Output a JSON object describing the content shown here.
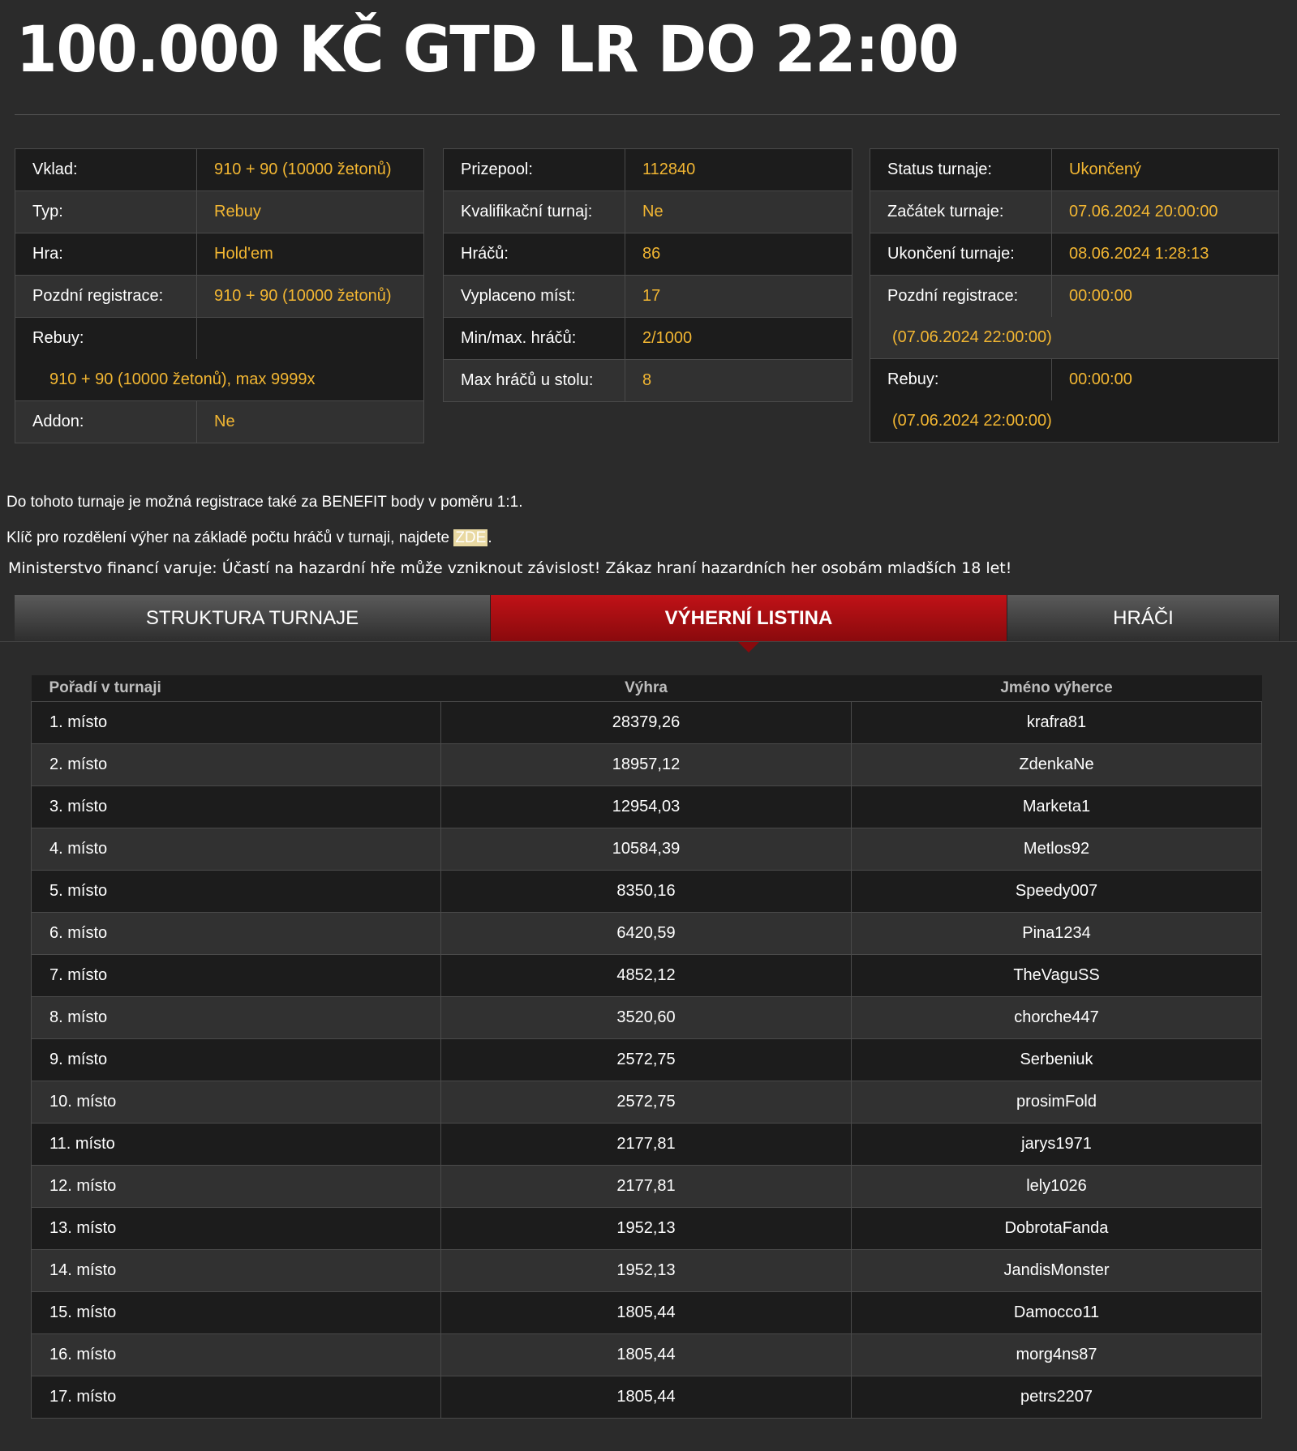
{
  "title": "100.000 KČ GTD LR DO 22:00",
  "info_left": [
    {
      "label": "Vklad:",
      "value": "910 + 90 (10000 žetonů)"
    },
    {
      "label": "Typ:",
      "value": "Rebuy"
    },
    {
      "label": "Hra:",
      "value": "Hold'em"
    },
    {
      "label": "Pozdní registrace:",
      "value": "910 + 90 (10000 žetonů)"
    },
    {
      "label": "Rebuy:",
      "value": "",
      "extra": "910 + 90 (10000 žetonů), max 9999x"
    },
    {
      "label": "Addon:",
      "value": "Ne"
    }
  ],
  "info_middle": [
    {
      "label": "Prizepool:",
      "value": "112840"
    },
    {
      "label": "Kvalifikační turnaj:",
      "value": "Ne"
    },
    {
      "label": "Hráčů:",
      "value": "86"
    },
    {
      "label": "Vyplaceno míst:",
      "value": "17"
    },
    {
      "label": "Min/max. hráčů:",
      "value": "2/1000"
    },
    {
      "label": "Max hráčů u stolu:",
      "value": "8"
    }
  ],
  "info_right": [
    {
      "label": "Status turnaje:",
      "value": "Ukončený"
    },
    {
      "label": "Začátek turnaje:",
      "value": "07.06.2024 20:00:00"
    },
    {
      "label": "Ukončení turnaje:",
      "value": "08.06.2024 1:28:13"
    },
    {
      "label": "Pozdní registrace:",
      "value": "00:00:00",
      "extra": "(07.06.2024 22:00:00)"
    },
    {
      "label": "Rebuy:",
      "value": "00:00:00",
      "extra": "(07.06.2024 22:00:00)"
    }
  ],
  "notes": {
    "benefit": "Do tohoto turnaje je možná registrace také za BENEFIT body v poměru 1:1.",
    "key_prefix": "Klíč pro rozdělení výher na základě počtu hráčů v turnaji, najdete ",
    "key_link": "ZDE",
    "key_suffix": ".",
    "warning": "Ministerstvo financí varuje: Účastí na hazardní hře může vzniknout závislost! Zákaz hraní hazardních her osobám mladších 18 let!"
  },
  "tabs": [
    {
      "label": "STRUKTURA TURNAJE",
      "active": false
    },
    {
      "label": "VÝHERNÍ LISTINA",
      "active": true
    },
    {
      "label": "HRÁČI",
      "active": false
    }
  ],
  "winners": {
    "headers": [
      "Pořadí v turnaji",
      "Výhra",
      "Jméno výherce"
    ],
    "rows": [
      [
        "1. místo",
        "28379,26",
        "krafra81"
      ],
      [
        "2. místo",
        "18957,12",
        "ZdenkaNe"
      ],
      [
        "3. místo",
        "12954,03",
        "Marketa1"
      ],
      [
        "4. místo",
        "10584,39",
        "Metlos92"
      ],
      [
        "5. místo",
        "8350,16",
        "Speedy007"
      ],
      [
        "6. místo",
        "6420,59",
        "Pina1234"
      ],
      [
        "7. místo",
        "4852,12",
        "TheVaguSS"
      ],
      [
        "8. místo",
        "3520,60",
        "chorche447"
      ],
      [
        "9. místo",
        "2572,75",
        "Serbeniuk"
      ],
      [
        "10. místo",
        "2572,75",
        "prosimFold"
      ],
      [
        "11. místo",
        "2177,81",
        "jarys1971"
      ],
      [
        "12. místo",
        "2177,81",
        "lely1026"
      ],
      [
        "13. místo",
        "1952,13",
        "DobrotaFanda"
      ],
      [
        "14. místo",
        "1952,13",
        "JandisMonster"
      ],
      [
        "15. místo",
        "1805,44",
        "Damocco11"
      ],
      [
        "16. místo",
        "1805,44",
        "morg4ns87"
      ],
      [
        "17. místo",
        "1805,44",
        "petrs2207"
      ]
    ]
  },
  "colors": {
    "accent_value": "#f2b632",
    "active_tab": "#c01217",
    "background": "#2b2b2b"
  }
}
